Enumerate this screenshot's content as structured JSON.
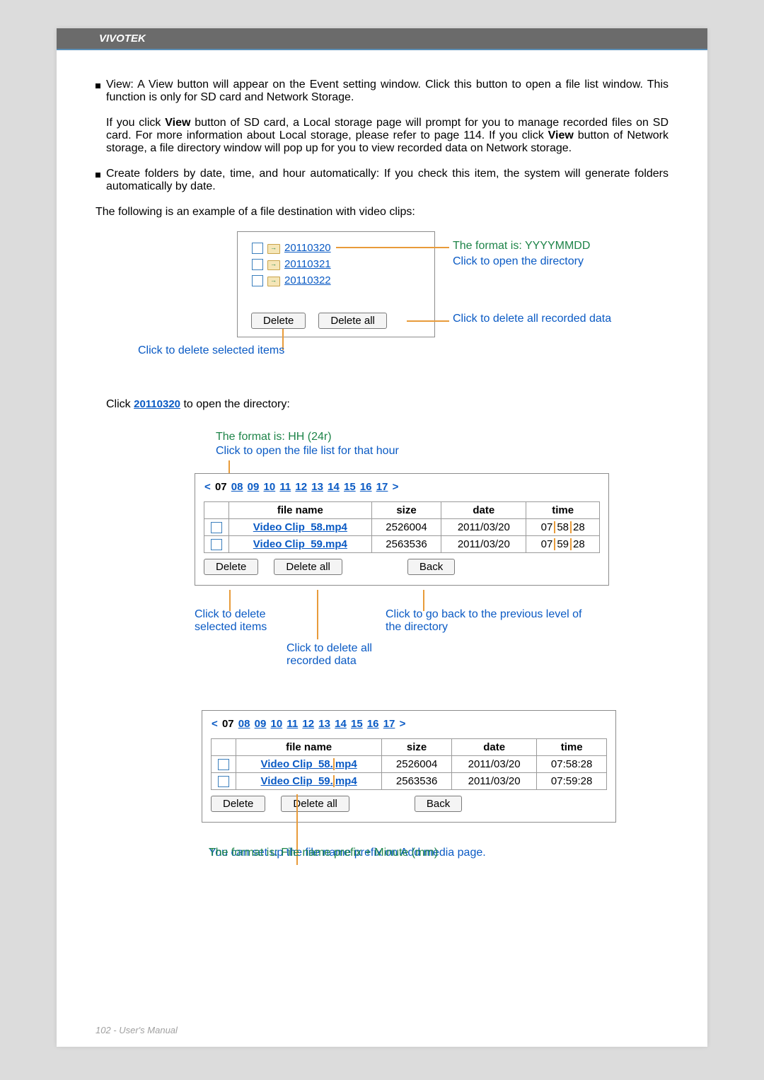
{
  "header": {
    "brand": "VIVOTEK"
  },
  "section1": {
    "view_label": "View: ",
    "view_text": "A View button will appear on the Event setting window. Click this button to open a file list window. This function is only for SD card and Network Storage.",
    "view_para2_a": "If you click ",
    "view_para2_b": "View",
    "view_para2_c": " button of SD card, a Local storage page will prompt for you to manage recorded files on SD card. For more information about Local storage, please refer to page 114. If you click ",
    "view_para2_d": "View",
    "view_para2_e": " button of Network storage, a file directory window will pop up for you to view recorded data on Network storage.",
    "create_text": "Create folders by date, time, and hour automatically: If you check this item, the system will generate folders automatically by date.",
    "following": "The following is an example of a file destination with video clips:"
  },
  "folders": {
    "f1": "20110320",
    "f2": "20110321",
    "f3": "20110322",
    "delete": "Delete",
    "delete_all": "Delete all"
  },
  "callouts1": {
    "format": "The format is: YYYYMMDD",
    "open": "Click to open the directory",
    "delall": "Click to delete all recorded data",
    "delsel": "Click to delete selected items"
  },
  "section2": {
    "click_a": "Click ",
    "click_link": "20110320",
    "click_b": " to open the directory:"
  },
  "callouts2": {
    "format": "The format is: HH (24r)",
    "open": "Click to open the file list for that hour",
    "delsel": "Click to delete selected items",
    "delall": "Click to delete all recorded data",
    "back": "Click to go back to the previous level of the directory"
  },
  "hours": {
    "left": "<",
    "current": "07",
    "h08": "08",
    "h09": "09",
    "h10": "10",
    "h11": "11",
    "h12": "12",
    "h13": "13",
    "h14": "14",
    "h15": "15",
    "h16": "16",
    "h17": "17",
    "right": ">"
  },
  "table_headers": {
    "fn": "file name",
    "size": "size",
    "date": "date",
    "time": "time"
  },
  "row1": {
    "fn": "Video Clip_58.mp4",
    "size": "2526004",
    "date": "2011/03/20",
    "time_a": "07",
    "time_b": "58",
    "time_c": "28",
    "fn_a": "Video Clip_58.",
    "fn_b": "mp4",
    "time_full": "07:58:28"
  },
  "row2": {
    "fn": "Video Clip_59.mp4",
    "size": "2563536",
    "date": "2011/03/20",
    "time_a": "07",
    "time_b": "59",
    "time_c": "28",
    "fn_a": "Video Clip_59.",
    "fn_b": "mp4",
    "time_full": "07:59:28"
  },
  "buttons2": {
    "delete": "Delete",
    "delete_all": "Delete all",
    "back": "Back"
  },
  "callouts3": {
    "format": "The format is: File name prefix + Minute (mm)",
    "setup": "You can set up the file name prefix on Add media page."
  },
  "footer": {
    "page": "102 - User's Manual"
  }
}
